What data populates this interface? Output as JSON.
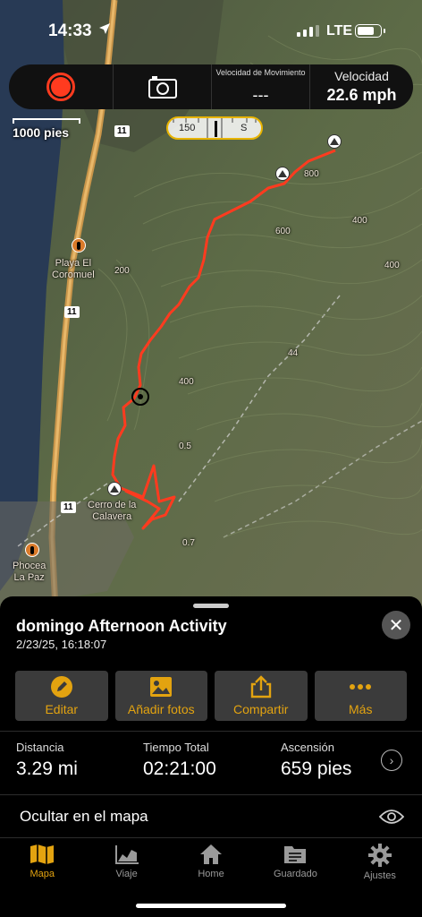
{
  "status": {
    "time": "14:33",
    "network": "LTE"
  },
  "toolbar": {
    "moving_speed_label": "Velocidad de Movimiento",
    "moving_speed_value": "---",
    "speed_label": "Velocidad",
    "speed_value": "22.6 mph"
  },
  "map": {
    "scale_label": "1000 pies",
    "compass": {
      "degrees": "150",
      "direction": "S"
    },
    "labels": {
      "poi1": "Playa El\nCoromuel",
      "poi2": "Cerro de la\nCalavera",
      "poi3": "Phocea\nLa Paz"
    },
    "road_badges": [
      "11",
      "11",
      "11",
      "11"
    ],
    "contours": [
      "200",
      "400",
      "600",
      "400",
      "200",
      "400",
      "44",
      "0.5",
      "0.7",
      "800",
      "400"
    ]
  },
  "activity": {
    "title": "domingo Afternoon Activity",
    "date": "2/23/25, 16:18:07"
  },
  "actions": [
    {
      "label": "Editar",
      "icon": "pencil-icon"
    },
    {
      "label": "Añadir fotos",
      "icon": "photo-icon"
    },
    {
      "label": "Compartir",
      "icon": "share-icon"
    },
    {
      "label": "Más",
      "icon": "more-icon"
    }
  ],
  "stats": [
    {
      "label": "Distancia",
      "value": "3.29 mi"
    },
    {
      "label": "Tiempo Total",
      "value": "02:21:00"
    },
    {
      "label": "Ascensión",
      "value": "659 pies"
    }
  ],
  "hide_on_map_label": "Ocultar en el mapa",
  "tabs": [
    {
      "label": "Mapa",
      "icon": "map-icon",
      "active": true
    },
    {
      "label": "Viaje",
      "icon": "chart-icon",
      "active": false
    },
    {
      "label": "Home",
      "icon": "home-icon",
      "active": false
    },
    {
      "label": "Guardado",
      "icon": "saved-icon",
      "active": false
    },
    {
      "label": "Ajustes",
      "icon": "gear-icon",
      "active": false
    }
  ],
  "colors": {
    "accent": "#e3a310",
    "track": "#ff3b1f",
    "map_green": "#5b6a44",
    "water": "#283a55"
  }
}
